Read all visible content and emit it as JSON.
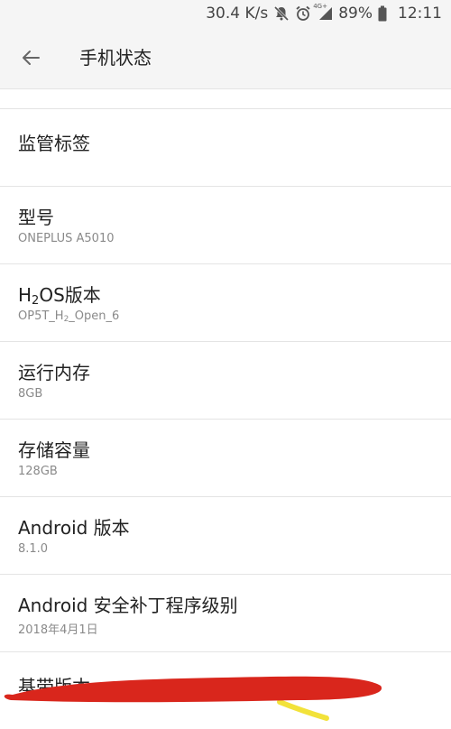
{
  "status_bar": {
    "net_speed": "30.4 K/s",
    "network_type": "4G+",
    "battery": "89%",
    "time": "12:11",
    "icons": [
      "mute-bell-icon",
      "alarm-icon",
      "signal-icon",
      "battery-icon"
    ]
  },
  "toolbar": {
    "back_icon": "arrow-left-icon",
    "title": "手机状态"
  },
  "items": [
    {
      "title": "监管标签"
    },
    {
      "title": "型号",
      "value": "ONEPLUS A5010"
    },
    {
      "title_pre": "H",
      "title_sub": "2",
      "title_post": "OS版本",
      "value_pre": "OP5T_H",
      "value_sub": "2",
      "value_post": "_Open_6"
    },
    {
      "title": "运行内存",
      "value": "8GB"
    },
    {
      "title": "存储容量",
      "value": "128GB"
    },
    {
      "title": "Android 版本",
      "value": "8.1.0"
    },
    {
      "title": "Android 安全补丁程序级别",
      "value": "2018年4月1日"
    },
    {
      "title": "基带版本"
    }
  ],
  "colors": {
    "background": "#ffffff",
    "bar_background": "#f5f5f5",
    "divider": "#e4e4e4",
    "primary_text": "#212121",
    "secondary_text": "#8a8a8a",
    "redaction_red": "#d9261c",
    "redaction_yellow": "#f2e23a"
  }
}
